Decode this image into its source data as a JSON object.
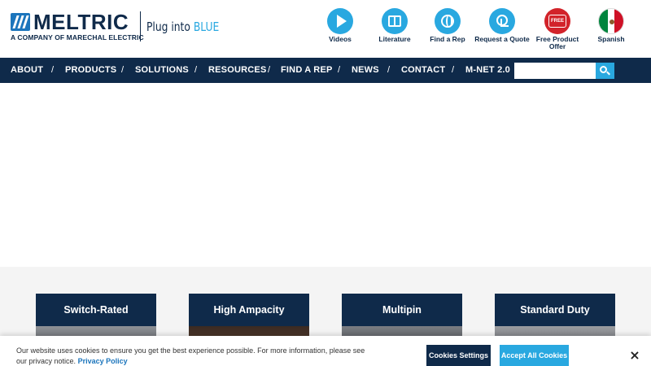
{
  "header": {
    "logo_text": "MELTRIC",
    "logo_subtext": "A COMPANY OF MARECHAL ELECTRIC",
    "tagline_main": "Plug into ",
    "tagline_accent": "BLUE",
    "quick_links": [
      {
        "label": "Videos",
        "icon": "play-icon"
      },
      {
        "label": "Literature",
        "icon": "book-icon"
      },
      {
        "label": "Find a Rep",
        "icon": "globe-icon"
      },
      {
        "label": "Request a Quote",
        "icon": "arrow-icon"
      },
      {
        "label": "Free Product Offer",
        "icon": "free-badge-icon",
        "badge_text": "FREE"
      },
      {
        "label": "Spanish",
        "icon": "mexico-flag-icon"
      }
    ]
  },
  "nav": {
    "items": [
      "ABOUT",
      "PRODUCTS",
      "SOLUTIONS",
      "RESOURCES",
      "FIND A REP",
      "NEWS",
      "CONTACT",
      "M-NET 2.0"
    ],
    "separator": "/",
    "search_placeholder": "",
    "search_icon": "search-icon"
  },
  "products": {
    "cards": [
      {
        "title": "Switch-Rated"
      },
      {
        "title": "High Ampacity"
      },
      {
        "title": "Multipin"
      },
      {
        "title": "Standard Duty"
      }
    ]
  },
  "cookie": {
    "text": "Our website uses cookies to ensure you get the best experience possible. For more information, please see our privacy notice.",
    "link_label": "Privacy Policy",
    "settings_label": "Cookies Settings",
    "accept_label": "Accept All Cookies",
    "close_label": "×"
  },
  "colors": {
    "navy": "#0f2a4a",
    "accent_blue": "#29a8e0",
    "red": "#d2232a"
  }
}
